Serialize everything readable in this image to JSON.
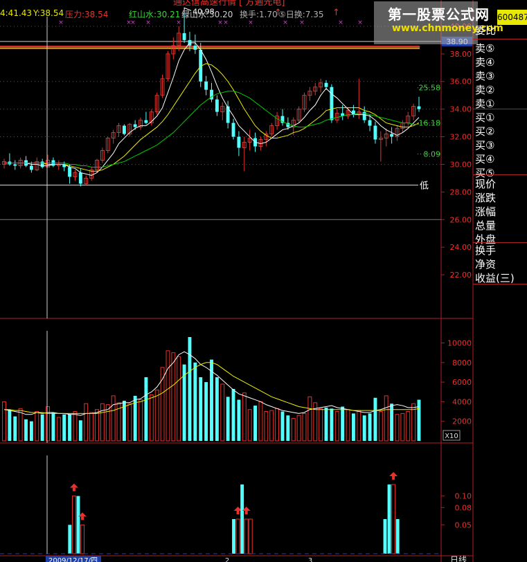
{
  "header": {
    "title": "通达信高速行情 [ 方通光电]",
    "stock_code": "600487",
    "x_readout": "4:41.43",
    "y_readout": "Y:38.54",
    "pressure": "压力:38.54",
    "red_mountain": "红山水:30.21",
    "green_mountain": "绿山水:30.20",
    "turnover": "换手:1.70",
    "five_day_turnover": "⑤日换:7.35"
  },
  "watermark": {
    "line1": "第一股票公式网",
    "line2": "www.chnmoney.com"
  },
  "sidebar": {
    "items": [
      "委比",
      "卖⑤",
      "卖④",
      "卖③",
      "卖②",
      "卖①",
      "买①",
      "买②",
      "买③",
      "买④",
      "买⑤",
      "现价",
      "涨跌",
      "涨幅",
      "总量",
      "外盘",
      "换手",
      "净资",
      "收益(三)"
    ]
  },
  "price_panel": {
    "current_price_tag": "38.90",
    "low_label": "低",
    "annotations": {
      "high": "40.98",
      "pct1": "25.58",
      "pct2": "16.18",
      "pct3": "8.09"
    }
  },
  "volume_panel": {
    "unit_label": "X10"
  },
  "bottom": {
    "date_label": "2009/12/17/四",
    "period_label": "日线",
    "month_marks": [
      "2",
      "3"
    ]
  },
  "colors": {
    "up": "#e8322d",
    "down": "#54ffff",
    "ma5": "#ffffff",
    "ma10": "#f0f000",
    "ma20": "#00cc00",
    "axis": "#b02020",
    "support": "#f5a400"
  },
  "chart_data": [
    {
      "type": "candlestick",
      "title": "",
      "ylim": [
        20.5,
        41.2
      ],
      "yticks": [
        22,
        24,
        26,
        28,
        30,
        32,
        34,
        36,
        38,
        40
      ],
      "horizontal_lines": {
        "pressure": 38.54,
        "current": 38.9,
        "low": 28.5,
        "level": 26.0
      },
      "candles": [
        [
          30.0,
          30.4,
          29.7,
          30.2
        ],
        [
          30.2,
          30.8,
          29.9,
          30.0
        ],
        [
          30.0,
          30.3,
          29.6,
          29.9
        ],
        [
          29.9,
          30.5,
          29.7,
          30.3
        ],
        [
          30.3,
          30.6,
          29.8,
          29.9
        ],
        [
          29.9,
          30.2,
          29.4,
          29.6
        ],
        [
          29.6,
          30.5,
          29.5,
          30.2
        ],
        [
          30.2,
          30.4,
          29.7,
          29.8
        ],
        [
          29.8,
          30.7,
          29.8,
          30.3
        ],
        [
          30.3,
          30.5,
          29.8,
          29.9
        ],
        [
          29.9,
          30.3,
          29.6,
          30.0
        ],
        [
          30.0,
          30.2,
          29.5,
          29.8
        ],
        [
          29.8,
          30.0,
          28.6,
          29.1
        ],
        [
          29.1,
          29.6,
          28.8,
          29.4
        ],
        [
          29.4,
          29.7,
          28.4,
          28.6
        ],
        [
          28.6,
          29.2,
          28.5,
          29.0
        ],
        [
          29.0,
          29.8,
          28.8,
          29.6
        ],
        [
          29.6,
          30.4,
          29.4,
          30.3
        ],
        [
          30.3,
          31.2,
          30.1,
          31.0
        ],
        [
          31.0,
          32.0,
          30.8,
          31.9
        ],
        [
          31.9,
          32.5,
          31.5,
          32.3
        ],
        [
          32.3,
          33.0,
          32.0,
          32.8
        ],
        [
          32.8,
          32.9,
          32.1,
          32.2
        ],
        [
          32.2,
          33.0,
          32.0,
          32.9
        ],
        [
          32.9,
          33.2,
          32.5,
          32.7
        ],
        [
          32.7,
          33.4,
          32.5,
          33.2
        ],
        [
          33.2,
          33.8,
          32.9,
          33.0
        ],
        [
          33.0,
          34.0,
          32.8,
          33.8
        ],
        [
          33.8,
          35.2,
          33.6,
          35.0
        ],
        [
          35.0,
          36.5,
          34.8,
          36.2
        ],
        [
          36.2,
          38.2,
          36.0,
          38.0
        ],
        [
          38.0,
          39.2,
          37.6,
          38.6
        ],
        [
          38.6,
          40.0,
          38.2,
          39.5
        ],
        [
          39.5,
          40.98,
          38.8,
          39.0
        ],
        [
          39.0,
          39.6,
          38.2,
          38.6
        ],
        [
          38.6,
          39.4,
          38.0,
          38.3
        ],
        [
          38.3,
          38.8,
          35.6,
          36.0
        ],
        [
          36.0,
          36.4,
          35.0,
          35.4
        ],
        [
          35.4,
          35.9,
          34.5,
          34.7
        ],
        [
          34.7,
          35.0,
          33.5,
          33.8
        ],
        [
          33.8,
          34.5,
          33.2,
          34.2
        ],
        [
          34.2,
          34.6,
          32.6,
          33.0
        ],
        [
          33.0,
          33.3,
          31.8,
          32.0
        ],
        [
          32.0,
          32.4,
          30.6,
          31.2
        ],
        [
          31.2,
          32.0,
          29.5,
          31.6
        ],
        [
          31.6,
          32.5,
          31.0,
          31.9
        ],
        [
          31.9,
          32.3,
          30.9,
          31.3
        ],
        [
          31.3,
          32.0,
          31.0,
          31.8
        ],
        [
          31.8,
          32.4,
          31.3,
          32.2
        ],
        [
          32.2,
          33.0,
          32.0,
          32.8
        ],
        [
          32.8,
          33.8,
          32.5,
          33.5
        ],
        [
          33.5,
          34.0,
          32.8,
          33.0
        ],
        [
          33.0,
          33.4,
          32.5,
          32.7
        ],
        [
          32.7,
          33.4,
          32.1,
          33.2
        ],
        [
          33.2,
          34.2,
          33.0,
          34.0
        ],
        [
          34.0,
          35.2,
          33.8,
          35.0
        ],
        [
          35.0,
          35.6,
          34.6,
          35.3
        ],
        [
          35.3,
          35.9,
          35.0,
          35.6
        ],
        [
          35.6,
          36.2,
          35.2,
          35.9
        ],
        [
          35.9,
          36.1,
          35.4,
          35.6
        ],
        [
          35.6,
          35.8,
          33.0,
          33.2
        ],
        [
          33.2,
          34.0,
          33.0,
          33.7
        ],
        [
          33.7,
          34.3,
          33.2,
          33.5
        ],
        [
          33.5,
          34.1,
          33.3,
          33.9
        ],
        [
          33.9,
          34.3,
          33.4,
          33.6
        ],
        [
          33.6,
          36.2,
          33.3,
          33.8
        ],
        [
          33.8,
          34.2,
          33.0,
          33.2
        ],
        [
          33.2,
          33.6,
          32.4,
          32.8
        ],
        [
          32.8,
          33.1,
          31.5,
          31.8
        ],
        [
          31.8,
          32.4,
          30.2,
          31.9
        ],
        [
          31.9,
          32.6,
          31.3,
          32.2
        ],
        [
          32.2,
          32.7,
          31.5,
          32.0
        ],
        [
          32.0,
          32.8,
          31.7,
          32.6
        ],
        [
          32.6,
          33.2,
          32.3,
          33.0
        ],
        [
          33.0,
          33.8,
          32.8,
          33.5
        ],
        [
          33.5,
          34.4,
          33.2,
          34.2
        ],
        [
          34.2,
          34.9,
          33.8,
          34.0
        ]
      ],
      "ma5": [
        30.1,
        30.1,
        30.1,
        30.1,
        30.1,
        30.0,
        30.0,
        29.9,
        29.9,
        30.0,
        30.0,
        30.0,
        29.8,
        29.7,
        29.4,
        29.3,
        29.2,
        29.4,
        29.8,
        30.3,
        30.8,
        31.5,
        31.9,
        32.3,
        32.6,
        32.8,
        32.8,
        33.1,
        33.5,
        34.1,
        35.2,
        36.3,
        37.5,
        38.3,
        38.8,
        38.8,
        38.3,
        37.6,
        36.7,
        35.7,
        34.8,
        34.1,
        33.5,
        32.8,
        32.4,
        32.0,
        31.6,
        31.5,
        31.6,
        31.9,
        32.2,
        32.5,
        32.6,
        32.8,
        33.0,
        33.4,
        33.9,
        34.3,
        35.0,
        35.5,
        35.1,
        34.8,
        34.4,
        34.0,
        33.6,
        33.6,
        33.6,
        33.5,
        33.2,
        32.8,
        32.5,
        32.3,
        32.1,
        32.3,
        32.6,
        33.0,
        33.4
      ],
      "ma10": [
        30.1,
        30.1,
        30.1,
        30.1,
        30.1,
        30.1,
        30.1,
        30.1,
        30.0,
        30.0,
        30.0,
        30.0,
        29.9,
        29.8,
        29.7,
        29.6,
        29.5,
        29.5,
        29.6,
        29.8,
        30.0,
        30.3,
        30.6,
        31.0,
        31.4,
        31.8,
        32.1,
        32.4,
        32.7,
        33.1,
        33.6,
        34.2,
        34.8,
        35.4,
        36.0,
        36.6,
        37.1,
        37.3,
        37.2,
        36.9,
        36.5,
        36.0,
        35.4,
        34.7,
        34.0,
        33.4,
        32.8,
        32.4,
        32.1,
        31.9,
        31.9,
        32.0,
        32.1,
        32.3,
        32.4,
        32.6,
        32.9,
        33.2,
        33.5,
        33.9,
        34.0,
        34.1,
        34.1,
        34.1,
        34.1,
        34.1,
        33.9,
        33.8,
        33.6,
        33.3,
        33.0,
        32.9,
        32.8,
        32.7,
        32.7,
        32.8,
        33.0
      ],
      "ma20": [
        30.1,
        30.1,
        30.1,
        30.1,
        30.1,
        30.1,
        30.1,
        30.1,
        30.1,
        30.1,
        30.1,
        30.1,
        30.0,
        30.0,
        29.9,
        29.9,
        29.8,
        29.8,
        29.8,
        29.9,
        30.0,
        30.1,
        30.2,
        30.4,
        30.6,
        30.8,
        31.0,
        31.2,
        31.4,
        31.7,
        32.0,
        32.3,
        32.7,
        33.1,
        33.5,
        33.9,
        34.3,
        34.6,
        34.9,
        35.1,
        35.2,
        35.3,
        35.3,
        35.2,
        35.0,
        34.8,
        34.5,
        34.2,
        33.9,
        33.6,
        33.3,
        33.1,
        32.9,
        32.8,
        32.7,
        32.7,
        32.8,
        32.9,
        33.0,
        33.2,
        33.3,
        33.4,
        33.5,
        33.6,
        33.6,
        33.7,
        33.7,
        33.6,
        33.5,
        33.4,
        33.3,
        33.2,
        33.1,
        33.0,
        33.0,
        32.9,
        32.9
      ]
    },
    {
      "type": "bar",
      "title": "",
      "unit": "X10",
      "ylim": [
        0,
        11000
      ],
      "yticks": [
        2000,
        4000,
        6000,
        8000,
        10000
      ],
      "values": [
        4000,
        3200,
        2500,
        3300,
        2200,
        2000,
        3000,
        2700,
        3500,
        2900,
        2400,
        2700,
        2700,
        3000,
        2100,
        3800,
        2900,
        3200,
        3800,
        3700,
        4600,
        3900,
        4100,
        3800,
        4600,
        4200,
        6500,
        4700,
        5200,
        7500,
        9200,
        9000,
        8600,
        7800,
        10600,
        8000,
        6500,
        6000,
        8300,
        6500,
        5800,
        4500,
        5300,
        4200,
        4900,
        3200,
        3600,
        4000,
        3000,
        3100,
        3300,
        3000,
        2600,
        2300,
        2600,
        2800,
        4500,
        3900,
        3300,
        3400,
        3300,
        3000,
        3500,
        3200,
        2800,
        3100,
        2600,
        2800,
        4400,
        3000,
        4600,
        3800,
        2700,
        2800,
        3000,
        3800,
        4200
      ],
      "ma5_line": [
        3200,
        3100,
        3000,
        2900,
        2700,
        2700,
        2900,
        2800,
        2900,
        2900,
        2800,
        2800,
        2700,
        2700,
        2600,
        2800,
        2800,
        2900,
        3100,
        3200,
        3700,
        3800,
        3900,
        3900,
        4200,
        4300,
        4700,
        5000,
        5500,
        6300,
        7400,
        8000,
        8800,
        9100,
        8800,
        8400,
        7800,
        7500,
        7100,
        6700,
        6200,
        5700,
        5200,
        4800,
        4600,
        4400,
        4200,
        4000,
        3700,
        3500,
        3300,
        3100,
        3000,
        2900,
        2800,
        2900,
        3200,
        3300,
        3400,
        3500,
        3600,
        3400,
        3300,
        3200,
        3100,
        3000,
        2900,
        2900,
        3100,
        3200,
        3400,
        3600,
        3700,
        3600,
        3400,
        3400,
        3500
      ],
      "ma10_line": [
        3200,
        3200,
        3100,
        3100,
        3000,
        2900,
        2900,
        2900,
        2800,
        2800,
        2800,
        2800,
        2800,
        2800,
        2800,
        2800,
        2800,
        2800,
        2900,
        3000,
        3100,
        3300,
        3500,
        3700,
        3900,
        4000,
        4200,
        4400,
        4600,
        4900,
        5300,
        5700,
        6200,
        6700,
        7100,
        7500,
        7800,
        8000,
        8000,
        7800,
        7400,
        7000,
        6600,
        6300,
        6000,
        5700,
        5400,
        5100,
        4800,
        4500,
        4300,
        4100,
        3900,
        3700,
        3500,
        3400,
        3300,
        3200,
        3200,
        3200,
        3200,
        3200,
        3200,
        3200,
        3100,
        3100,
        3100,
        3100,
        3100,
        3100,
        3200,
        3200,
        3200,
        3200,
        3200,
        3200,
        3300
      ]
    },
    {
      "type": "bar",
      "title": "",
      "ylim": [
        0,
        0.155
      ],
      "yticks": [
        0.05,
        0.08,
        0.1
      ],
      "bars": [
        {
          "index": 12,
          "value": 0.05,
          "kind": "down"
        },
        {
          "index": 13,
          "value": 0.1,
          "kind": "up",
          "arrow": true
        },
        {
          "index": 14,
          "value": 0.1,
          "kind": "down"
        },
        {
          "index": 15,
          "value": 0.05,
          "kind": "up",
          "arrow": true
        },
        {
          "index": 51,
          "value": 0.06,
          "kind": "down"
        },
        {
          "index": 52,
          "value": 0.06,
          "kind": "up",
          "arrow": true
        },
        {
          "index": 53,
          "value": 0.12,
          "kind": "down"
        },
        {
          "index": 54,
          "value": 0.06,
          "kind": "up",
          "arrow": true
        },
        {
          "index": 55,
          "value": 0.06,
          "kind": "up"
        },
        {
          "index": 87,
          "value": 0.06,
          "kind": "down"
        },
        {
          "index": 88,
          "value": 0.12,
          "kind": "down"
        },
        {
          "index": 89,
          "value": 0.12,
          "kind": "up",
          "arrow": true
        },
        {
          "index": 90,
          "value": 0.06,
          "kind": "down"
        }
      ]
    }
  ]
}
